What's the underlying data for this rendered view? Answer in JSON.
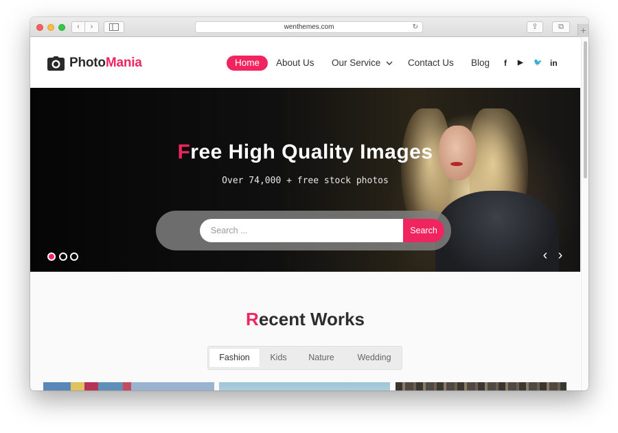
{
  "browser": {
    "url": "wenthemes.com",
    "nav_back_glyph": "‹",
    "nav_forward_glyph": "›",
    "reload_glyph": "↻",
    "share_glyph": "⇪",
    "tabs_glyph": "⧉",
    "new_tab_glyph": "+"
  },
  "header": {
    "logo_primary": "Photo",
    "logo_accent": "Mania",
    "menu": {
      "home": "Home",
      "about": "About Us",
      "service": "Our Service",
      "contact": "Contact Us",
      "blog": "Blog"
    },
    "social": {
      "facebook": "f",
      "youtube": "▶",
      "twitter": "🐦",
      "linkedin": "in"
    }
  },
  "hero": {
    "title_first": "F",
    "title_rest": "ree High Quality Images",
    "subtitle": "Over 74,000 + free stock photos",
    "search_placeholder": "Search ...",
    "search_button": "Search",
    "slide_count": 3,
    "active_slide": 1,
    "prev_glyph": "‹",
    "next_glyph": "›"
  },
  "works": {
    "title_first": "R",
    "title_rest": "ecent Works",
    "filters": [
      "Fashion",
      "Kids",
      "Nature",
      "Wedding"
    ],
    "active_filter": "Fashion"
  },
  "colors": {
    "accent": "#f0255f",
    "text_dark": "#2a2a2a"
  },
  "icons": {
    "logo": "camera-icon",
    "service_dropdown": "chevron-down-icon"
  }
}
